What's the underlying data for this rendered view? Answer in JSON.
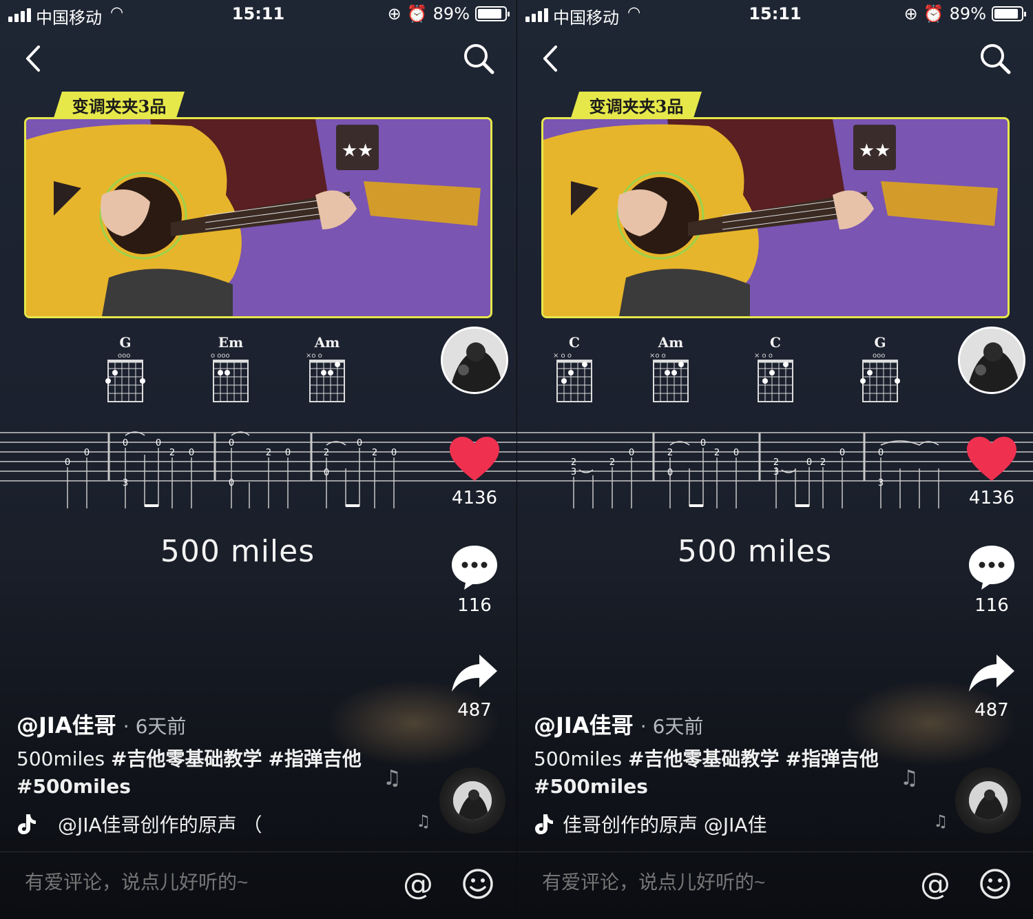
{
  "screens": [
    {
      "status": {
        "carrier": "中国移动",
        "time": "15:11",
        "battery": "89%",
        "battery_level": 0.89
      },
      "capo": "变调夹夹3品",
      "chords": [
        "G",
        "Em",
        "Am"
      ],
      "tab_numbers": [
        "0",
        "0",
        "0",
        "3",
        "0",
        "2",
        "0",
        "0",
        "0",
        "2",
        "0",
        "2",
        "0",
        "0",
        "2",
        "0"
      ],
      "song_title": "500 miles",
      "likes": "4136",
      "comments": "116",
      "shares": "487",
      "author": "@JIA佳哥",
      "time_ago": "· 6天前",
      "caption_plain": "500miles ",
      "caption_tags": [
        "#吉他零基础教学",
        "#指弹吉他",
        "#500miles"
      ],
      "music": "@JIA佳哥创作的原声    （",
      "comment_placeholder": "有爱评论，说点儿好听的~",
      "at": "@"
    },
    {
      "status": {
        "carrier": "中国移动",
        "time": "15:11",
        "battery": "89%",
        "battery_level": 0.89
      },
      "capo": "变调夹夹3品",
      "chords": [
        "C",
        "Am",
        "C",
        "G"
      ],
      "tab_numbers": [
        "2",
        "3",
        "2",
        "0",
        "2",
        "0",
        "0",
        "2",
        "0",
        "2",
        "3",
        "0",
        "2",
        "0",
        "0",
        "3"
      ],
      "song_title": "500 miles",
      "likes": "4136",
      "comments": "116",
      "shares": "487",
      "author": "@JIA佳哥",
      "time_ago": "· 6天前",
      "caption_plain": "500miles ",
      "caption_tags": [
        "#吉他零基础教学",
        "#指弹吉他",
        "#500miles"
      ],
      "music": "佳哥创作的原声    @JIA佳",
      "comment_placeholder": "有爱评论，说点儿好听的~",
      "at": "@"
    }
  ],
  "colors": {
    "accent_yellow": "#e6e84a",
    "like_red": "#f0304f",
    "background": "#1c2230"
  },
  "icons": [
    "back-icon",
    "search-icon",
    "heart-icon",
    "comment-bubble-icon",
    "share-arrow-icon",
    "music-note-icon",
    "tiktok-note-icon",
    "at-icon",
    "emoji-icon"
  ]
}
